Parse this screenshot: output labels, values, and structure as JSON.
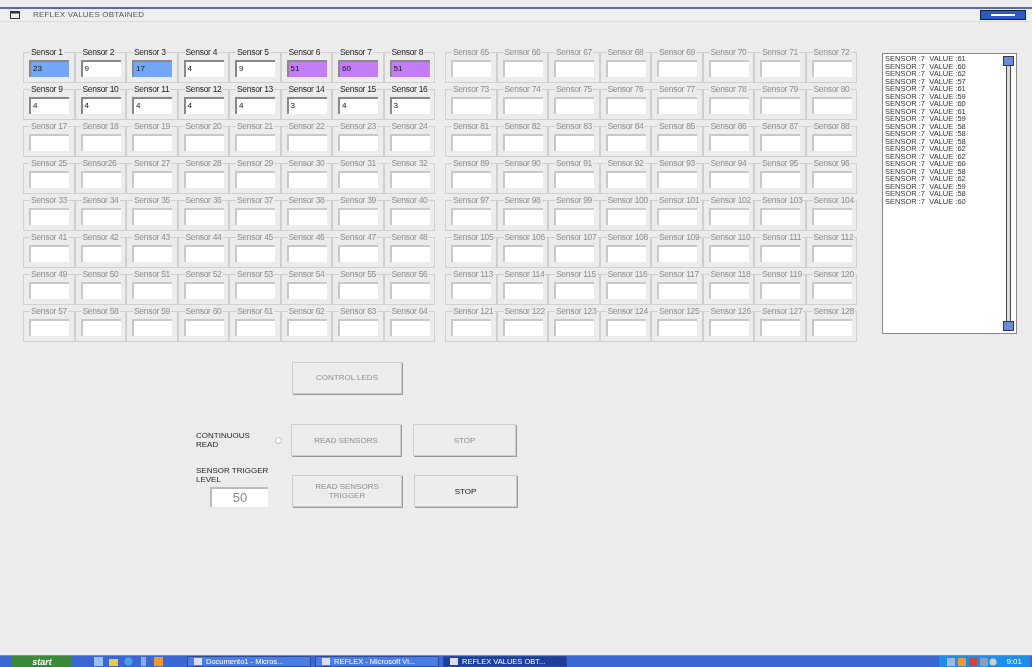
{
  "window": {
    "title": "REFLEX VALUES OBTAINED"
  },
  "left_panel": [
    {
      "label": "Sensor 1",
      "value": "23",
      "disabled": false,
      "color": "#74a6f8"
    },
    {
      "label": "Sensor 2",
      "value": "9",
      "disabled": false
    },
    {
      "label": "Sensor 3",
      "value": "17",
      "disabled": false,
      "color": "#74a6f8"
    },
    {
      "label": "Sensor 4",
      "value": "4",
      "disabled": false
    },
    {
      "label": "Sensor 5",
      "value": "9",
      "disabled": false
    },
    {
      "label": "Sensor 6",
      "value": "51",
      "disabled": false,
      "color": "#c27cf6"
    },
    {
      "label": "Sensor 7",
      "value": "60",
      "disabled": false,
      "color": "#c27cf6"
    },
    {
      "label": "Sensor 8",
      "value": "51",
      "disabled": false,
      "color": "#c27cf6"
    },
    {
      "label": "Sensor 9",
      "value": "4",
      "disabled": false
    },
    {
      "label": "Sensor 10",
      "value": "4",
      "disabled": false
    },
    {
      "label": "Sensor 11",
      "value": "4",
      "disabled": false
    },
    {
      "label": "Sensor 12",
      "value": "4",
      "disabled": false
    },
    {
      "label": "Sensor 13",
      "value": "4",
      "disabled": false
    },
    {
      "label": "Sensor 14",
      "value": "3",
      "disabled": false
    },
    {
      "label": "Sensor 15",
      "value": "4",
      "disabled": false
    },
    {
      "label": "Sensor 16",
      "value": "3",
      "disabled": false
    },
    {
      "label": "Sensor 17",
      "disabled": true
    },
    {
      "label": "Sensor 18",
      "disabled": true
    },
    {
      "label": "Sensor 19",
      "disabled": true
    },
    {
      "label": "Sensor 20",
      "disabled": true
    },
    {
      "label": "Sensor 21",
      "disabled": true
    },
    {
      "label": "Sensor 22",
      "disabled": true
    },
    {
      "label": "Sensor 23",
      "disabled": true
    },
    {
      "label": "Sensor 24",
      "disabled": true
    },
    {
      "label": "Sensor 25",
      "disabled": true
    },
    {
      "label": "Sensor26",
      "disabled": true
    },
    {
      "label": "Sensor 27",
      "disabled": true
    },
    {
      "label": "Sensor 28",
      "disabled": true
    },
    {
      "label": "Sensor 29",
      "disabled": true
    },
    {
      "label": "Sensor 30",
      "disabled": true
    },
    {
      "label": "Sensor 31",
      "disabled": true
    },
    {
      "label": "Sensor 32",
      "disabled": true
    },
    {
      "label": "Sensor 33",
      "disabled": true
    },
    {
      "label": "Sensor 34",
      "disabled": true
    },
    {
      "label": "Sensor 35",
      "disabled": true
    },
    {
      "label": "Sensor 36",
      "disabled": true
    },
    {
      "label": "Sensor 37",
      "disabled": true
    },
    {
      "label": "Sensor 38",
      "disabled": true
    },
    {
      "label": "Sensor 39",
      "disabled": true
    },
    {
      "label": "Sensor 40",
      "disabled": true
    },
    {
      "label": "Sensor 41",
      "disabled": true
    },
    {
      "label": "Sensor 42",
      "disabled": true
    },
    {
      "label": "Sensor 43",
      "disabled": true
    },
    {
      "label": "Sensor 44",
      "disabled": true
    },
    {
      "label": "Sensor 45",
      "disabled": true
    },
    {
      "label": "Sensor 46",
      "disabled": true
    },
    {
      "label": "Sensor 47",
      "disabled": true
    },
    {
      "label": "Sensor 48",
      "disabled": true
    },
    {
      "label": "Sensor 49",
      "disabled": true
    },
    {
      "label": "Sensor 50",
      "disabled": true
    },
    {
      "label": "Sensor 51",
      "disabled": true
    },
    {
      "label": "Sensor 52",
      "disabled": true
    },
    {
      "label": "Sensor 53",
      "disabled": true
    },
    {
      "label": "Sensor 54",
      "disabled": true
    },
    {
      "label": "Sensor 55",
      "disabled": true
    },
    {
      "label": "Sensor 56",
      "disabled": true
    },
    {
      "label": "Sensor 57",
      "disabled": true
    },
    {
      "label": "Sensor 58",
      "disabled": true
    },
    {
      "label": "Sensor 59",
      "disabled": true
    },
    {
      "label": "Sensor 60",
      "disabled": true
    },
    {
      "label": "Sensor 61",
      "disabled": true
    },
    {
      "label": "Sensor 62",
      "disabled": true
    },
    {
      "label": "Sensor 63",
      "disabled": true
    },
    {
      "label": "Sensor 64",
      "disabled": true
    }
  ],
  "right_panel": [
    {
      "label": "Sensor 65",
      "disabled": true
    },
    {
      "label": "Sensor 66",
      "disabled": true
    },
    {
      "label": "Sensor 67",
      "disabled": true
    },
    {
      "label": "Sensor 68",
      "disabled": true
    },
    {
      "label": "Sensor 69",
      "disabled": true
    },
    {
      "label": "Sensor 70",
      "disabled": true
    },
    {
      "label": "Sensor 71",
      "disabled": true
    },
    {
      "label": "Sensor 72",
      "disabled": true
    },
    {
      "label": "Sensor 73",
      "disabled": true
    },
    {
      "label": "Sensor 74",
      "disabled": true
    },
    {
      "label": "Sensor 75",
      "disabled": true
    },
    {
      "label": "Sensor 76",
      "disabled": true
    },
    {
      "label": "Sensor 77",
      "disabled": true
    },
    {
      "label": "Sensor 78",
      "disabled": true
    },
    {
      "label": "Sensor 79",
      "disabled": true
    },
    {
      "label": "Sensor 80",
      "disabled": true
    },
    {
      "label": "Sensor 81",
      "disabled": true
    },
    {
      "label": "Sensor 82",
      "disabled": true
    },
    {
      "label": "Sensor 83",
      "disabled": true
    },
    {
      "label": "Sensor 84",
      "disabled": true
    },
    {
      "label": "Sensor 85",
      "disabled": true
    },
    {
      "label": "Sensor 86",
      "disabled": true
    },
    {
      "label": "Sensor 87",
      "disabled": true
    },
    {
      "label": "Sensor 88",
      "disabled": true
    },
    {
      "label": "Sensor 89",
      "disabled": true
    },
    {
      "label": "Sensor 90",
      "disabled": true
    },
    {
      "label": "Sensor 91",
      "disabled": true
    },
    {
      "label": "Sensor 92",
      "disabled": true
    },
    {
      "label": "Sensor 93",
      "disabled": true
    },
    {
      "label": "Sensor 94",
      "disabled": true
    },
    {
      "label": "Sensor 95",
      "disabled": true
    },
    {
      "label": "Sensor 96",
      "disabled": true
    },
    {
      "label": "Sensor 97",
      "disabled": true
    },
    {
      "label": "Sensor 98",
      "disabled": true
    },
    {
      "label": "Sensor 99",
      "disabled": true
    },
    {
      "label": "Sensor 100",
      "disabled": true
    },
    {
      "label": "Sensor 101",
      "disabled": true
    },
    {
      "label": "Sensor 102",
      "disabled": true
    },
    {
      "label": "Sensor 103",
      "disabled": true
    },
    {
      "label": "Sensor 104",
      "disabled": true
    },
    {
      "label": "Sensor 105",
      "disabled": true
    },
    {
      "label": "Sensor 106",
      "disabled": true
    },
    {
      "label": "Sensor 107",
      "disabled": true
    },
    {
      "label": "Sensor 108",
      "disabled": true
    },
    {
      "label": "Sensor 109",
      "disabled": true
    },
    {
      "label": "Sensor 110",
      "disabled": true
    },
    {
      "label": "Sensor 111",
      "disabled": true
    },
    {
      "label": "Sensor 112",
      "disabled": true
    },
    {
      "label": "Sensor 113",
      "disabled": true
    },
    {
      "label": "Sensor 114",
      "disabled": true
    },
    {
      "label": "Sensor 115",
      "disabled": true
    },
    {
      "label": "Sensor 116",
      "disabled": true
    },
    {
      "label": "Sensor 117",
      "disabled": true
    },
    {
      "label": "Sensor 118",
      "disabled": true
    },
    {
      "label": "Sensor 119",
      "disabled": true
    },
    {
      "label": "Sensor 120",
      "disabled": true
    },
    {
      "label": "Sensor 121",
      "disabled": true
    },
    {
      "label": "Sensor 122",
      "disabled": true
    },
    {
      "label": "Sensor 123",
      "disabled": true
    },
    {
      "label": "Sensor 124",
      "disabled": true
    },
    {
      "label": "Sensor 125",
      "disabled": true
    },
    {
      "label": "Sensor 126",
      "disabled": true
    },
    {
      "label": "Sensor 127",
      "disabled": true
    },
    {
      "label": "Sensor 128",
      "disabled": true
    }
  ],
  "log": [
    "SENSOR :7  VALUE :61",
    "SENSOR :7  VALUE :60",
    "SENSOR :7  VALUE :62",
    "SENSOR :7  VALUE :57",
    "SENSOR :7  VALUE :61",
    "SENSOR :7  VALUE :59",
    "SENSOR :7  VALUE :60",
    "SENSOR :7  VALUE :61",
    "SENSOR :7  VALUE :59",
    "SENSOR :7  VALUE :58",
    "SENSOR :7  VALUE :58",
    "SENSOR :7  VALUE :58",
    "SENSOR :7  VALUE :62",
    "SENSOR :7  VALUE :62",
    "SENSOR :7  VALUE :60",
    "SENSOR :7  VALUE :58",
    "SENSOR :7  VALUE :62",
    "SENSOR :7  VALUE :59",
    "SENSOR :7  VALUE :58",
    "SENSOR :7  VALUE :60"
  ],
  "control_leds": {
    "label": "CONTROL LEDS",
    "disabled": true
  },
  "continuous_read": {
    "label": "CONTINUOUS READ",
    "checked": false,
    "buttons": [
      {
        "label": "READ SENSORS",
        "disabled": true
      },
      {
        "label": "STOP",
        "disabled": true
      }
    ]
  },
  "trigger": {
    "label": "SENSOR TRIGGER LEVEL",
    "value": "50",
    "disabled": true,
    "buttons": [
      {
        "label": "READ SENSORS TRIGGER",
        "disabled": true
      },
      {
        "label": "STOP",
        "disabled": false
      }
    ]
  },
  "taskbar": {
    "start": "start",
    "tasks": [
      {
        "label": "Documento1 - Micros...",
        "selected": false
      },
      {
        "label": "REFLEX - Microsoft Vi...",
        "selected": false
      },
      {
        "label": "REFLEX VALUES OBT...",
        "selected": true
      }
    ],
    "clock": "9:01"
  }
}
